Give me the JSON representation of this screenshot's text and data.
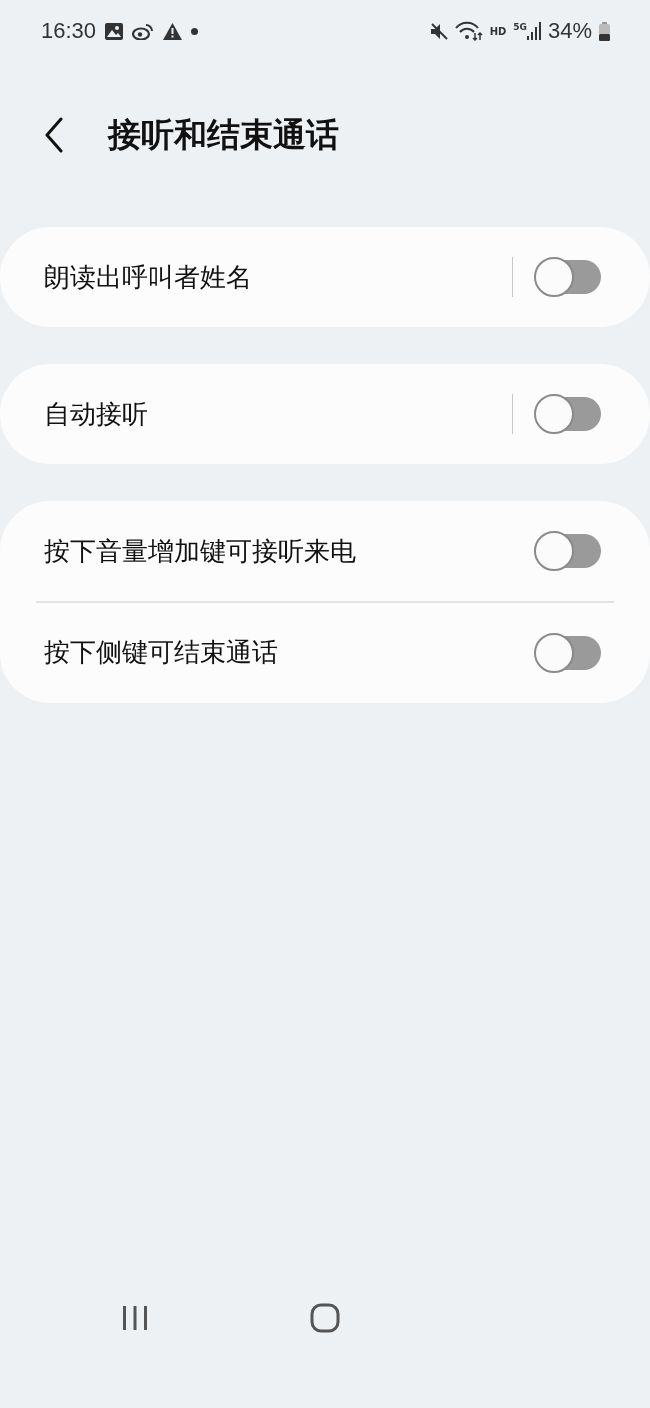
{
  "status_bar": {
    "time": "16:30",
    "network": "HD",
    "cellular": "5G",
    "battery": "34%"
  },
  "header": {
    "title": "接听和结束通话"
  },
  "groups": [
    {
      "items": [
        {
          "label": "朗读出呼叫者姓名",
          "kind": "split",
          "on": false
        }
      ]
    },
    {
      "items": [
        {
          "label": "自动接听",
          "kind": "split",
          "on": false
        }
      ]
    },
    {
      "items": [
        {
          "label": "按下音量增加键可接听来电",
          "kind": "plain",
          "on": false
        },
        {
          "label": "按下侧键可结束通话",
          "kind": "plain",
          "on": false
        }
      ]
    }
  ]
}
